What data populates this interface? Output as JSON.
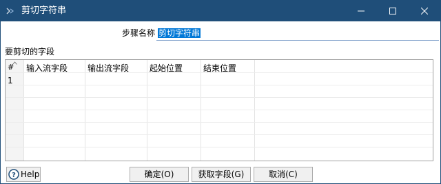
{
  "window": {
    "title": "剪切字符串",
    "controls": {
      "minimize_icon": "minimize-icon",
      "maximize_icon": "maximize-icon",
      "close_icon": "close-icon"
    }
  },
  "form": {
    "step_name_label": "步骤名称",
    "step_name_value": "剪切字符串"
  },
  "fields_section": {
    "label": "要剪切的字段",
    "table": {
      "row_header_symbol": "#",
      "columns": [
        "输入流字段",
        "输出流字段",
        "起始位置",
        "结束位置"
      ],
      "rows": [
        {
          "index": "1",
          "cells": [
            "",
            "",
            "",
            ""
          ]
        }
      ]
    }
  },
  "buttons": {
    "help": "Help",
    "ok": "确定(O)",
    "get_fields": "获取字段(G)",
    "cancel": "取消(C)"
  },
  "colors": {
    "titlebar": "#1f4e79",
    "selection": "#0078d7"
  }
}
